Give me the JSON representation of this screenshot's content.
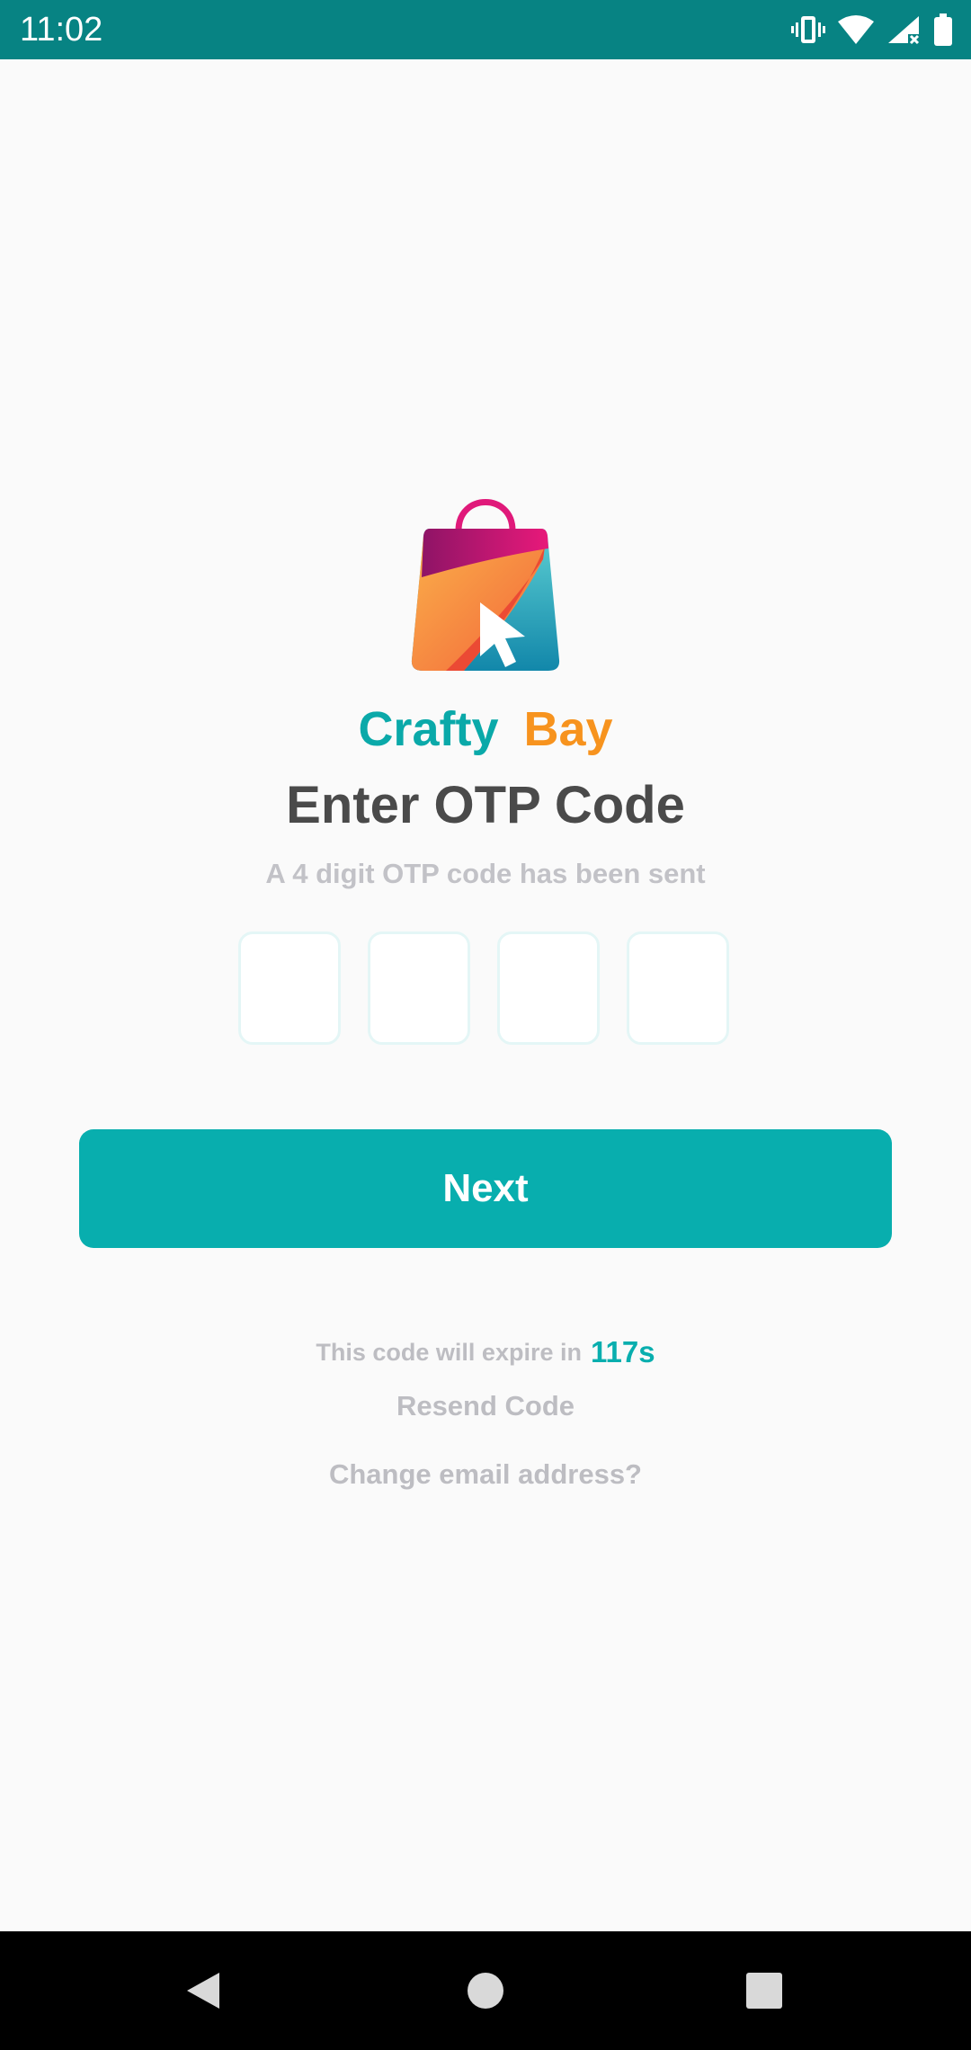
{
  "status_bar": {
    "time": "11:02",
    "icons": [
      "vibrate-icon",
      "wifi-icon",
      "signal-icon",
      "battery-icon"
    ]
  },
  "brand": {
    "word1": "Crafty",
    "word2": "Bay",
    "color1": "#0AA9A9",
    "color2": "#F7931E"
  },
  "screen": {
    "title": "Enter OTP Code",
    "subtitle": "A 4 digit OTP code has been sent"
  },
  "otp": {
    "digits": [
      "",
      "",
      "",
      ""
    ]
  },
  "actions": {
    "next_label": "Next",
    "expire_label": "This code will expire in",
    "expire_countdown": "117s",
    "resend_label": "Resend Code",
    "change_email_label": "Change email address?"
  },
  "colors": {
    "accent": "#08AEAE",
    "status_bar": "#078383",
    "background": "#FAFAFA"
  },
  "nav_bar": {
    "icons": [
      "back-icon",
      "home-icon",
      "recents-icon"
    ]
  }
}
